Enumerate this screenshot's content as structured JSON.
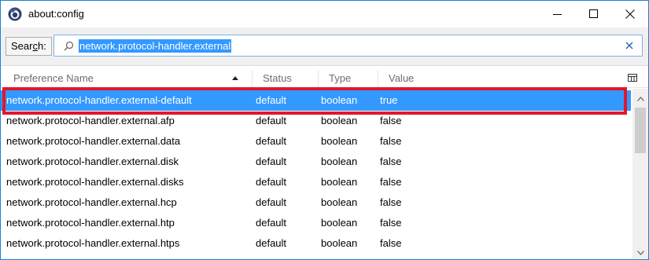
{
  "window": {
    "title": "about:config",
    "icon": "firefox-logo-icon"
  },
  "search": {
    "label_prefix": "Sear",
    "label_accel": "c",
    "label_suffix": "h:",
    "value": "network.protocol-handler.external",
    "clear_icon": "close-icon"
  },
  "columns": {
    "name": "Preference Name",
    "status": "Status",
    "type": "Type",
    "value": "Value",
    "sorted_by": "Preference Name",
    "sort_direction": "ascending"
  },
  "rows": [
    {
      "name": "network.protocol-handler.external-default",
      "status": "default",
      "type": "boolean",
      "value": "true",
      "selected": true
    },
    {
      "name": "network.protocol-handler.external.afp",
      "status": "default",
      "type": "boolean",
      "value": "false"
    },
    {
      "name": "network.protocol-handler.external.data",
      "status": "default",
      "type": "boolean",
      "value": "false"
    },
    {
      "name": "network.protocol-handler.external.disk",
      "status": "default",
      "type": "boolean",
      "value": "false"
    },
    {
      "name": "network.protocol-handler.external.disks",
      "status": "default",
      "type": "boolean",
      "value": "false"
    },
    {
      "name": "network.protocol-handler.external.hcp",
      "status": "default",
      "type": "boolean",
      "value": "false"
    },
    {
      "name": "network.protocol-handler.external.htp",
      "status": "default",
      "type": "boolean",
      "value": "false"
    },
    {
      "name": "network.protocol-handler.external.htps",
      "status": "default",
      "type": "boolean",
      "value": "false"
    }
  ],
  "colors": {
    "selection": "#3399ff",
    "highlight_border": "#e2172a",
    "window_border": "#1883d7"
  }
}
